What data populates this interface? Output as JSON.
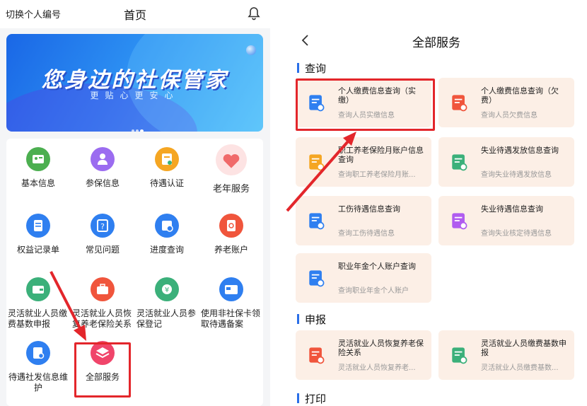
{
  "left": {
    "header": {
      "switch_label": "切换个人编号",
      "title": "首页",
      "bell_icon": "bell-icon"
    },
    "banner": {
      "slogan": "您身边的社保管家",
      "subtitle": "更贴心更安心"
    },
    "grid_items": [
      {
        "label": "基本信息",
        "icon": "id-card-icon",
        "color": "#4caf50"
      },
      {
        "label": "参保信息",
        "icon": "person-icon",
        "color": "#9b6cf0"
      },
      {
        "label": "待遇认证",
        "icon": "certificate-icon",
        "color": "#f5a623"
      },
      {
        "label": "老年服务",
        "icon": "elderly-heart-icon",
        "color": "#f06a6a"
      },
      {
        "label": "权益记录单",
        "icon": "document-icon",
        "color": "#2f7ff0"
      },
      {
        "label": "常见问题",
        "icon": "question-icon",
        "color": "#2f7ff0"
      },
      {
        "label": "进度查询",
        "icon": "progress-icon",
        "color": "#2f7ff0"
      },
      {
        "label": "养老账户",
        "icon": "account-icon",
        "color": "#f0553c"
      },
      {
        "label": "灵活就业人员缴费基数申报",
        "icon": "wallet-icon",
        "color": "#3bb07a"
      },
      {
        "label": "灵活就业人员恢复养老保险关系",
        "icon": "briefcase-icon",
        "color": "#f0553c"
      },
      {
        "label": "灵活就业人员参保登记",
        "icon": "money-icon",
        "color": "#3bb07a"
      },
      {
        "label": "使用非社保卡领取待遇备案",
        "icon": "card-apply-icon",
        "color": "#2f7ff0"
      },
      {
        "label": "待遇社发信息维护",
        "icon": "user-doc-icon",
        "color": "#2f7ff0"
      },
      {
        "label": "全部服务",
        "icon": "layers-icon",
        "color": "#f0456a"
      }
    ]
  },
  "right": {
    "title": "全部服务",
    "sections": [
      {
        "name": "查询",
        "cards": [
          {
            "title": "个人缴费信息查询（实缴）",
            "sub": "查询人员实缴信息",
            "icon": "doc-search-icon",
            "color": "#2f7ff0"
          },
          {
            "title": "个人缴费信息查询（欠费）",
            "sub": "查询人员欠费信息",
            "icon": "doc-search-red-icon",
            "color": "#f0553c"
          },
          {
            "title": "职工养老保险月账户信息查询",
            "sub": "查询职工养老保险月账...",
            "icon": "pension-account-icon",
            "color": "#f5a623"
          },
          {
            "title": "失业待遇发放信息查询",
            "sub": "查询失业待遇发放信息",
            "icon": "job-payment-icon",
            "color": "#3bb07a"
          },
          {
            "title": "工伤待遇信息查询",
            "sub": "查询工伤待遇信息",
            "icon": "worker-icon",
            "color": "#2f7ff0"
          },
          {
            "title": "失业待遇信息查询",
            "sub": "查询失业核定待遇信息",
            "icon": "job-search-icon",
            "color": "#b05cf0"
          },
          {
            "title": "职业年金个人账户查询",
            "sub": "查询职业年金个人账户",
            "icon": "id-list-icon",
            "color": "#2f7ff0"
          }
        ]
      },
      {
        "name": "申报",
        "cards": [
          {
            "title": "灵活就业人员恢复养老保险关系",
            "sub": "灵活就业人员恢复养老...",
            "icon": "briefcase-icon",
            "color": "#f0553c"
          },
          {
            "title": "灵活就业人员缴费基数申报",
            "sub": "灵活就业人员缴费基数...",
            "icon": "wallet-icon",
            "color": "#3bb07a"
          }
        ]
      },
      {
        "name": "打印",
        "cards": []
      }
    ]
  }
}
